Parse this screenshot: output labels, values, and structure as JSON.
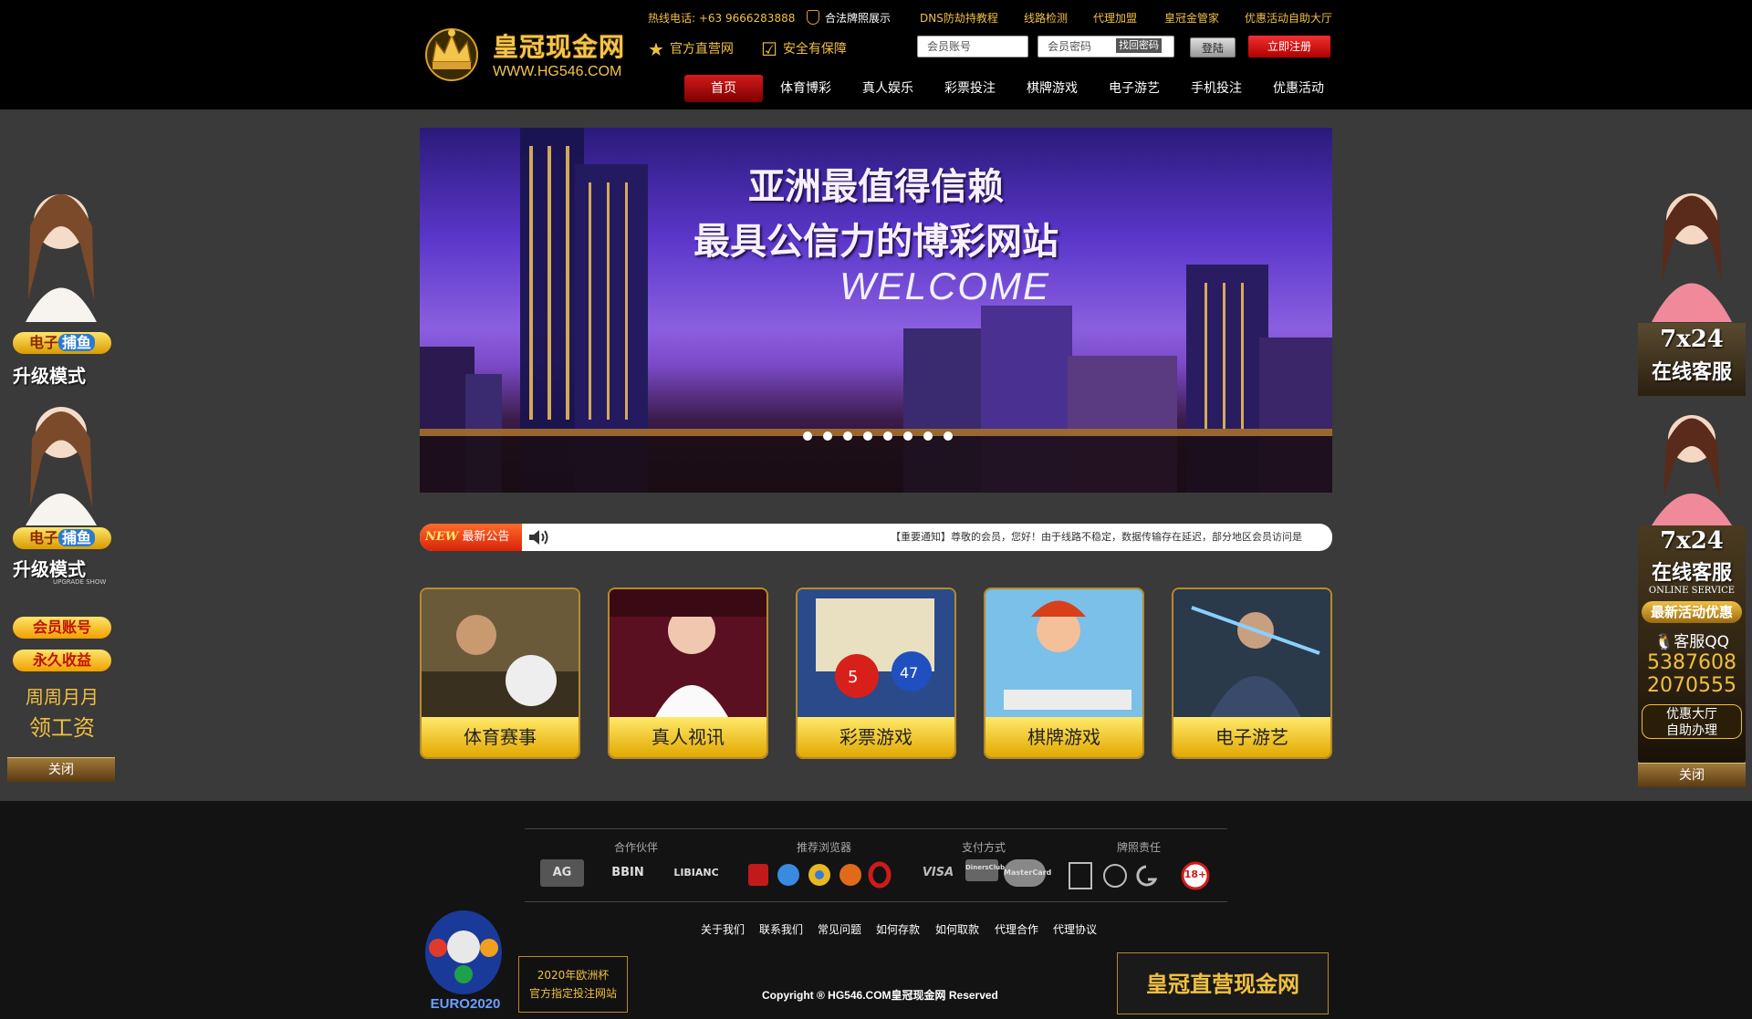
{
  "header": {
    "brand_name": "皇冠现金网",
    "brand_url": "WWW.HG546.COM",
    "hotline": "热线电话: +63 9666283888",
    "top_links": [
      "合法牌照展示",
      "DNS防劫持教程",
      "线路检测",
      "代理加盟",
      "皇冠金管家",
      "优惠活动自助大厅"
    ],
    "features": [
      "官方直营网",
      "安全有保障"
    ],
    "account_placeholder": "会员账号",
    "password_placeholder": "会员密码",
    "forgot_label": "找回密码",
    "login_label": "登陆",
    "register_label": "立即注册",
    "nav": [
      "首页",
      "体育博彩",
      "真人娱乐",
      "彩票投注",
      "棋牌游戏",
      "电子游艺",
      "手机投注",
      "优惠活动"
    ],
    "active_nav": "首页"
  },
  "banner": {
    "line1": "亚洲最值得信赖",
    "line2": "最具公信力的博彩网站",
    "line3": "WELCOME",
    "slide_count": 8
  },
  "notice": {
    "new_label": "NEW",
    "label": "最新公告",
    "text": "【重要通知】尊敬的会员，您好！由于线路不稳定，数据传输存在延迟，部分地区会员访问是"
  },
  "games": [
    "体育赛事",
    "真人视讯",
    "彩票游戏",
    "棋牌游戏",
    "电子游艺"
  ],
  "left_float": {
    "tag1_a": "电子",
    "tag1_b": "捕鱼",
    "upgrade": "升级模式",
    "upgrade_sub": "UPGRADE SHOW",
    "member_account": "会员账号",
    "forever_income": "永久收益",
    "weekly_a": "周周月月",
    "weekly_b": "领工资",
    "close": "关闭"
  },
  "right_float": {
    "badge": "7x24",
    "service": "在线客服",
    "service_en": "ONLINE SERVICE",
    "latest": "最新活动优惠",
    "qq_label": "客服QQ",
    "qq1": "5387608",
    "qq2": "2070555",
    "hall_a": "优惠大厅",
    "hall_b": "自助办理",
    "close": "关闭"
  },
  "footer": {
    "heads": [
      "合作伙伴",
      "推荐浏览器",
      "支付方式",
      "牌照责任"
    ],
    "partners": [
      "AG",
      "BBIN",
      "LIBIANC"
    ],
    "payments": [
      "VISA",
      "DinersClub",
      "MasterCard"
    ],
    "age": "18+",
    "links": [
      "关于我们",
      "联系我们",
      "常见问题",
      "如何存款",
      "如何取款",
      "代理合作",
      "代理协议"
    ],
    "copyright": "Copyright ® HG546.COM皇冠现金网 Reserved",
    "euro_label": "EURO2020",
    "euro_box1": "2020年欧洲杯",
    "euro_box2": "官方指定投注网站",
    "hg_box": "皇冠直营现金网"
  },
  "colors": {
    "gold": "#f0c040",
    "red": "#c00000",
    "header_bg": "#000000",
    "page_bg": "#3a3a3a"
  }
}
